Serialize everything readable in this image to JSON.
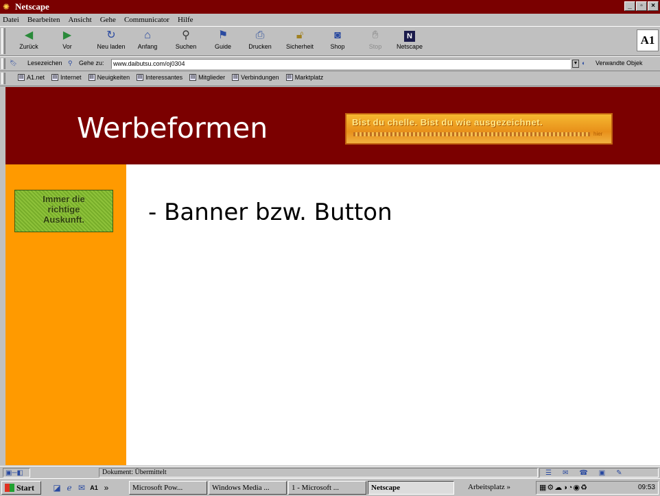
{
  "window": {
    "title": "Netscape",
    "app_icon": "netscape-app-icon"
  },
  "menu": [
    "Datei",
    "Bearbeiten",
    "Ansicht",
    "Gehe",
    "Communicator",
    "Hilfe"
  ],
  "toolbar": {
    "buttons": [
      {
        "label": "Zurück",
        "icon": "arrow-left-icon"
      },
      {
        "label": "Vor",
        "icon": "arrow-right-icon"
      },
      {
        "label": "Neu laden",
        "icon": "reload-icon"
      },
      {
        "label": "Anfang",
        "icon": "home-icon"
      },
      {
        "label": "Suchen",
        "icon": "search-icon"
      },
      {
        "label": "Guide",
        "icon": "guide-icon"
      },
      {
        "label": "Drucken",
        "icon": "print-icon"
      },
      {
        "label": "Sicherheit",
        "icon": "lock-icon"
      },
      {
        "label": "Shop",
        "icon": "shop-icon"
      },
      {
        "label": "Stop",
        "icon": "stop-icon",
        "disabled": true
      },
      {
        "label": "Netscape",
        "icon": "netscape-icon"
      }
    ],
    "brand_logo": "A1"
  },
  "location": {
    "bookmarks_label": "Lesezeichen",
    "goto_label": "Gehe zu:",
    "url": "www.daibutsu.com/oj0304",
    "related_label": "Verwandte Objek"
  },
  "personal_toolbar": [
    "A1.net",
    "Internet",
    "Neuigkeiten",
    "Interessantes",
    "Mitglieder",
    "Verbindungen",
    "Marktplatz"
  ],
  "page": {
    "title": "Werbeformen",
    "banner_ad_text": "Bist du chelle. Bist du wie ausgezeichnet.",
    "banner_ad_suffix": "hier",
    "sidebar_button_lines": [
      "Immer die",
      "richtige",
      "Auskunft."
    ],
    "bullet": "- Banner bzw. Button",
    "colors": {
      "header": "#7b0000",
      "sidebar": "#ff9a00",
      "sidebar_button": "#8ec23a"
    }
  },
  "status": {
    "text": "Dokument: Übermittelt"
  },
  "taskbar": {
    "start": "Start",
    "chevron": "»",
    "tasks": [
      "Microsoft Pow...",
      "Windows Media ...",
      "1 - Microsoft ...",
      "Netscape"
    ],
    "active_task": "Netscape",
    "arbeitsplatz": "Arbeitsplatz »",
    "clock": "09:53"
  }
}
